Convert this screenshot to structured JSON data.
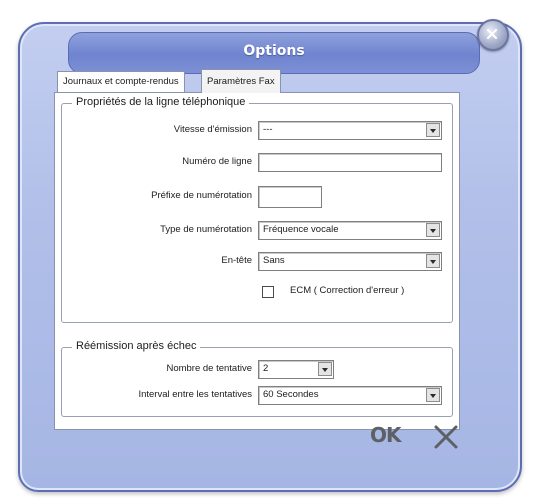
{
  "window": {
    "title": "Options"
  },
  "tabs": [
    {
      "label": "Journaux et compte-rendus"
    },
    {
      "label": "Paramètres Fax"
    }
  ],
  "line_group": {
    "legend": "Propriétés de la ligne téléphonique",
    "vitesse": {
      "label": "Vitesse d'émission",
      "value": "---"
    },
    "numero": {
      "label": "Numéro de ligne",
      "value": ""
    },
    "prefixe": {
      "label": "Préfixe de numérotation",
      "value": ""
    },
    "type": {
      "label": "Type de numérotation",
      "value": "Fréquence vocale"
    },
    "entete": {
      "label": "En-tête",
      "value": "Sans"
    },
    "ecm": {
      "label": "ECM ( Correction d'erreur )",
      "checked": false
    }
  },
  "retry_group": {
    "legend": "Réémission après échec",
    "tentative": {
      "label": "Nombre de tentative",
      "value": "2"
    },
    "interval": {
      "label": "Interval entre les tentatives",
      "value": "60 Secondes"
    }
  },
  "footer": {
    "ok_label": "OK"
  }
}
